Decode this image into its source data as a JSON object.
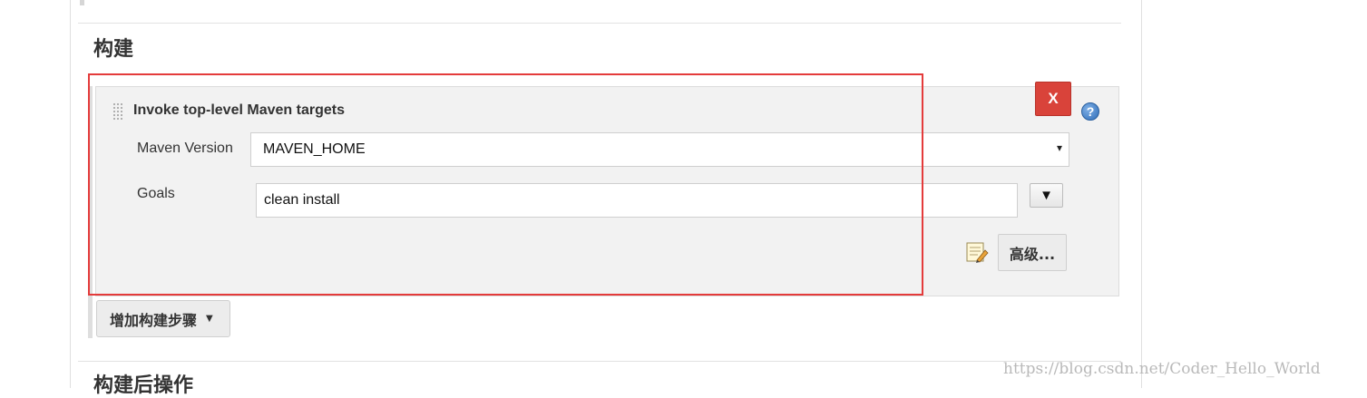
{
  "section": {
    "title": "构建"
  },
  "builder": {
    "title": "Invoke top-level Maven targets",
    "delete_label": "X",
    "help_label": "?",
    "maven_version": {
      "label": "Maven Version",
      "value": "MAVEN_HOME",
      "caret": "▾"
    },
    "goals": {
      "label": "Goals",
      "value": "clean install",
      "expand_label": "▼"
    },
    "advanced_label": "高级..."
  },
  "add_step": {
    "label": "增加构建步骤",
    "caret": "▼"
  },
  "next_section": {
    "title": "构建后操作"
  },
  "watermark": "https://blog.csdn.net/Coder_Hello_World",
  "colors": {
    "delete": "#d9433a",
    "highlight_box": "#e43b3b",
    "help": "#2f6db8"
  }
}
